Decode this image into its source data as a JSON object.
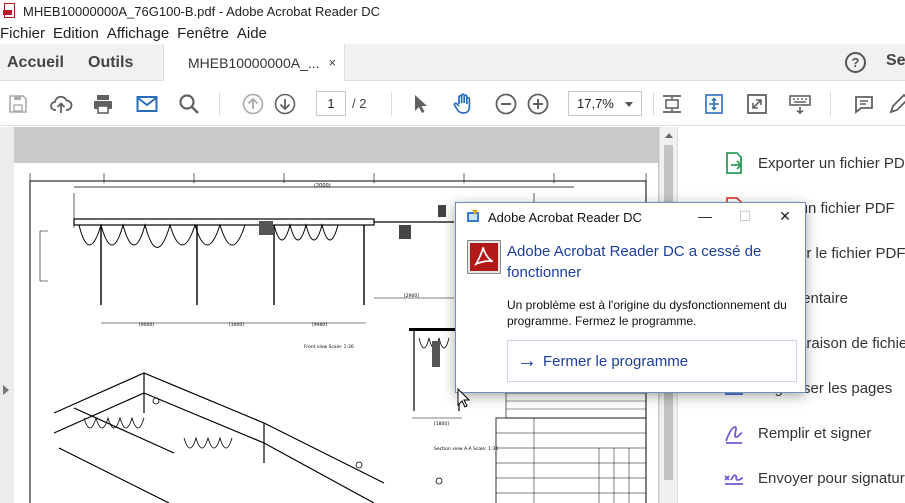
{
  "window": {
    "title": "MHEB10000000A_76G100-B.pdf - Adobe Acrobat Reader DC"
  },
  "menu": {
    "items": [
      "Fichier",
      "Edition",
      "Affichage",
      "Fenêtre",
      "Aide"
    ]
  },
  "tabs": {
    "home": "Accueil",
    "tools": "Outils",
    "document": "MHEB10000000A_...",
    "close": "×",
    "help": "?",
    "signin": "Se"
  },
  "toolbar": {
    "page_current": "1",
    "page_total": "/ 2",
    "zoom": "17,7%"
  },
  "drawing": {
    "front_view": "Front view\nScale: 1:30",
    "section_view": "Section view A-A\nScale: 1:30",
    "dims": [
      "[3000]",
      "[9000]",
      "[3000]",
      "[9460]",
      "[2900]",
      "[1800]",
      "(2000)"
    ]
  },
  "right_panel": {
    "tools": [
      {
        "label": "Exporter un fichier PDF",
        "icon": "export-pdf-icon",
        "color": "#2e9d5b"
      },
      {
        "label": "Créer un fichier PDF",
        "icon": "create-pdf-icon",
        "color": "#e0453a"
      },
      {
        "label": "Modifier le fichier PDF",
        "icon": "edit-pdf-icon",
        "color": "#b24fcc"
      },
      {
        "label": "Commentaire",
        "icon": "comment-icon",
        "color": "#e8b21a"
      },
      {
        "label": "Comparaison de fichiers",
        "icon": "compare-icon",
        "color": "#e0453a"
      },
      {
        "label": "Organiser les pages",
        "icon": "organize-pages-icon",
        "color": "#3b6fd6"
      },
      {
        "label": "Remplir et signer",
        "icon": "fill-sign-icon",
        "color": "#6e5bd6"
      },
      {
        "label": "Envoyer pour signature",
        "icon": "send-signature-icon",
        "color": "#6e5bd6"
      }
    ]
  },
  "dialog": {
    "title": "Adobe Acrobat Reader DC",
    "minimize": "—",
    "maximize": "☐",
    "close": "✕",
    "heading": "Adobe Acrobat Reader DC a cessé de fonctionner",
    "message": "Un problème est à l'origine du dysfonctionnement du programme. Fermez le programme.",
    "button": "Fermer le programme",
    "button_arrow": "→"
  },
  "colors": {
    "accent": "#1a3e9e",
    "acrobat_red": "#b11a16",
    "toolbar_icon": "#606060",
    "mail_icon": "#2a6ebb"
  }
}
